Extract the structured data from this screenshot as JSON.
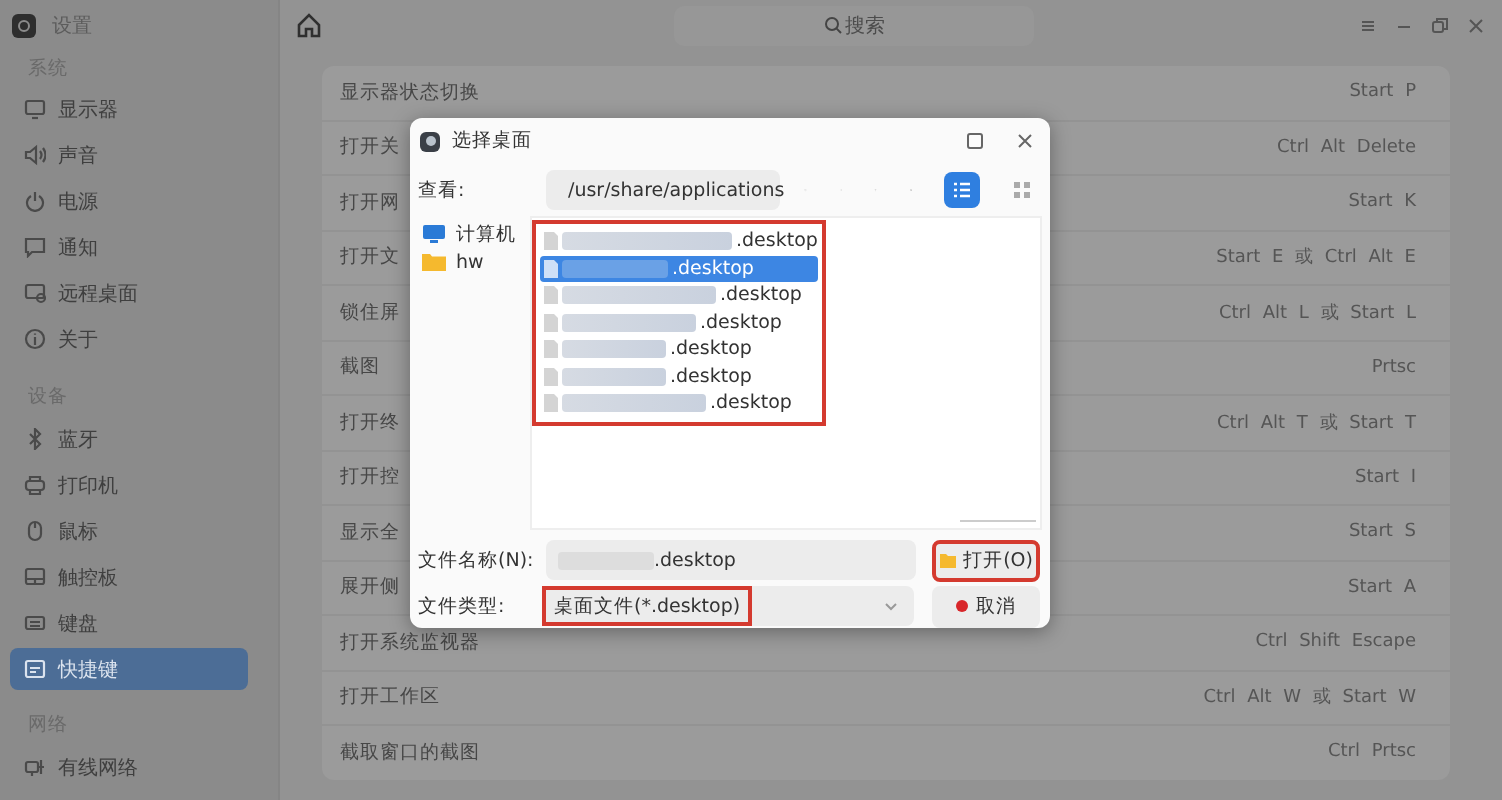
{
  "app": {
    "title": "设置"
  },
  "sidebar": {
    "groups": [
      {
        "heading": "系统",
        "items": [
          {
            "label": "显示器",
            "selected": false
          },
          {
            "label": "声音",
            "selected": false
          },
          {
            "label": "电源",
            "selected": false
          },
          {
            "label": "通知",
            "selected": false
          },
          {
            "label": "远程桌面",
            "selected": false
          },
          {
            "label": "关于",
            "selected": false
          }
        ]
      },
      {
        "heading": "设备",
        "items": [
          {
            "label": "蓝牙",
            "selected": false
          },
          {
            "label": "打印机",
            "selected": false
          },
          {
            "label": "鼠标",
            "selected": false
          },
          {
            "label": "触控板",
            "selected": false
          },
          {
            "label": "键盘",
            "selected": false
          },
          {
            "label": "快捷键",
            "selected": true
          }
        ]
      },
      {
        "heading": "网络",
        "items": [
          {
            "label": "有线网络",
            "selected": false
          }
        ]
      }
    ]
  },
  "topbar": {
    "search_placeholder": "搜索"
  },
  "shortcuts": [
    {
      "name": "显示器状态切换",
      "keys": "Start P"
    },
    {
      "name": "打开关",
      "keys": "Ctrl Alt Delete"
    },
    {
      "name": "打开网",
      "keys": "Start K"
    },
    {
      "name": "打开文",
      "keys": "Start E 或 Ctrl Alt E"
    },
    {
      "name": "锁住屏",
      "keys": "Ctrl Alt L 或 Start L"
    },
    {
      "name": "截图",
      "keys": "Prtsc"
    },
    {
      "name": "打开终",
      "keys": "Ctrl Alt T 或 Start T"
    },
    {
      "name": "打开控",
      "keys": "Start I"
    },
    {
      "name": "显示全",
      "keys": "Start S"
    },
    {
      "name": "展开侧",
      "keys": "Start A"
    },
    {
      "name": "打开系统监视器",
      "keys": "Ctrl Shift Escape"
    },
    {
      "name": "打开工作区",
      "keys": "Ctrl Alt W 或 Start W"
    },
    {
      "name": "截取窗口的截图",
      "keys": "Ctrl Prtsc"
    }
  ],
  "dialog": {
    "title": "选择桌面",
    "look_in_label": "查看:",
    "path": "/usr/share/applications",
    "view_modes": [
      {
        "kind": "list",
        "selected": true
      },
      {
        "kind": "icons",
        "selected": false
      }
    ],
    "places": [
      {
        "label": "计算机"
      },
      {
        "label": "hw"
      }
    ],
    "files_highlighted": true,
    "files": [
      {
        "name": ".desktop",
        "selected": false
      },
      {
        "name": ".desktop",
        "selected": true
      },
      {
        "name": ".desktop",
        "selected": false
      },
      {
        "name": ".desktop",
        "selected": false
      },
      {
        "name": ".desktop",
        "selected": false
      },
      {
        "name": ".desktop",
        "selected": false
      },
      {
        "name": ".desktop",
        "selected": false
      }
    ],
    "filename_label": "文件名称(N):",
    "filename_value": ".desktop",
    "filetype_label": "文件类型:",
    "filetype_value": "桌面文件(*.desktop)",
    "filetype_highlighted": true,
    "open_button": "打开(O)",
    "open_highlighted": true,
    "cancel_button": "取消"
  }
}
